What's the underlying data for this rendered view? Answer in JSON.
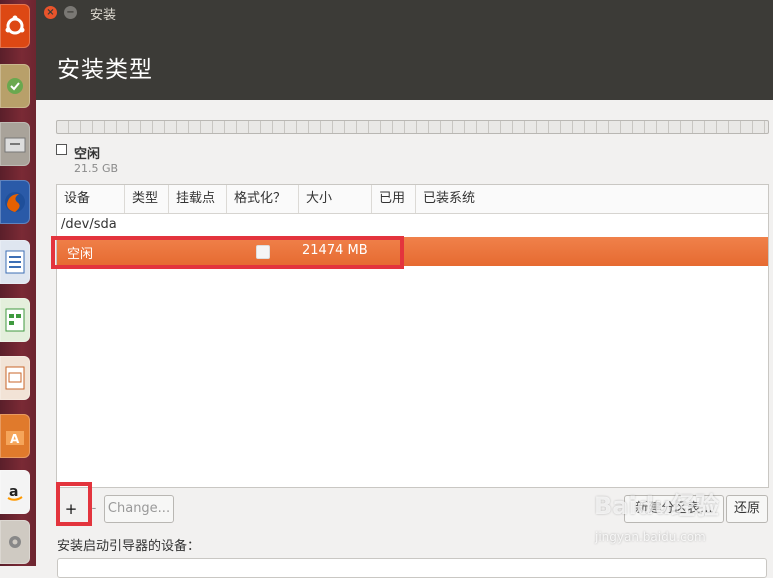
{
  "window": {
    "title": "安装"
  },
  "header": {
    "title": "安装类型"
  },
  "legend": {
    "name": "空闲",
    "size": "21.5 GB"
  },
  "table": {
    "columns": [
      "设备",
      "类型",
      "挂载点",
      "格式化？",
      "大小",
      "已用",
      "已装系统"
    ],
    "device": "/dev/sda",
    "selected_row": {
      "name": "空闲",
      "size": "21474 MB",
      "format_checked": false
    }
  },
  "buttons": {
    "add": "+",
    "remove": "-",
    "change": "Change...",
    "new_partition_table": "新建分区表...",
    "revert": "还原"
  },
  "bootloader": {
    "label": "安装启动引导器的设备："
  },
  "watermark": {
    "brand": "Baidu经验",
    "url": "jingyan.baidu.com"
  },
  "colors": {
    "selection": "#e95420",
    "highlight_box": "#e3343d",
    "titlebar": "#3c3b37"
  },
  "launcher": {
    "icons": [
      "ubuntu-dash-icon",
      "software-updater-icon",
      "files-icon",
      "firefox-icon",
      "writer-icon",
      "calc-icon",
      "impress-icon",
      "software-center-icon",
      "amazon-icon",
      "settings-icon"
    ]
  }
}
